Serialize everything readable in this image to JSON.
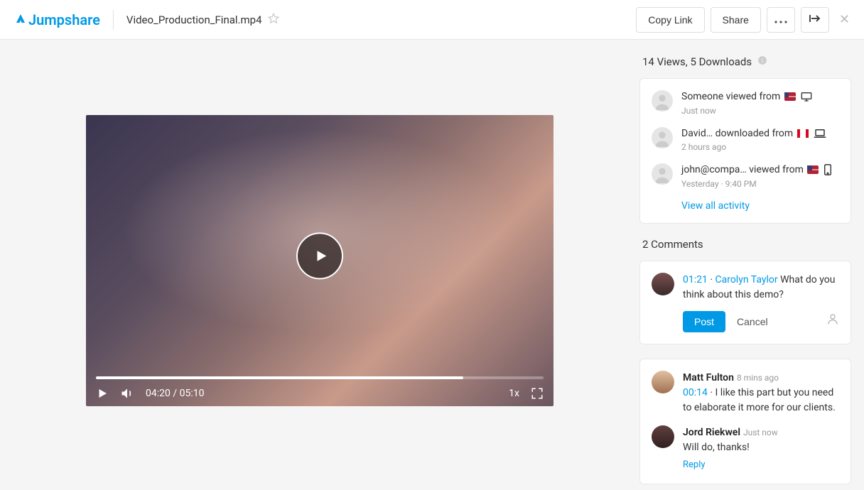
{
  "header": {
    "logo_text": "Jumpshare",
    "filename": "Video_Production_Final.mp4",
    "copy_link": "Copy Link",
    "share": "Share"
  },
  "player": {
    "current_time": "04:20",
    "duration": "05:10",
    "speed": "1x"
  },
  "stats": {
    "views_label": "14 Views,",
    "downloads_label": "5 Downloads"
  },
  "activity": [
    {
      "text_a": "Someone viewed from",
      "flag": "us",
      "device": "desktop",
      "time": "Just now"
    },
    {
      "text_a": "David… downloaded from",
      "flag": "ca",
      "device": "laptop",
      "time": "2 hours ago"
    },
    {
      "text_a": "john@compa… viewed from",
      "flag": "us",
      "device": "mobile",
      "time": "Yesterday · 9:40 PM"
    }
  ],
  "view_all": "View all activity",
  "comments_title": "2 Comments",
  "compose": {
    "timestamp": "01:21",
    "sep": " · ",
    "author": "Carolyn Taylor",
    "text": " What do you think about this demo?",
    "post": "Post",
    "cancel": "Cancel"
  },
  "comments": [
    {
      "name": "Matt Fulton",
      "meta": "8 mins ago",
      "timestamp": "00:14",
      "sep": " · ",
      "text": "I like this part but you need to elaborate it more for our clients."
    },
    {
      "name": "Jord Riekwel",
      "meta": "Just now",
      "text_only": "Will do, thanks!",
      "reply": "Reply"
    }
  ]
}
